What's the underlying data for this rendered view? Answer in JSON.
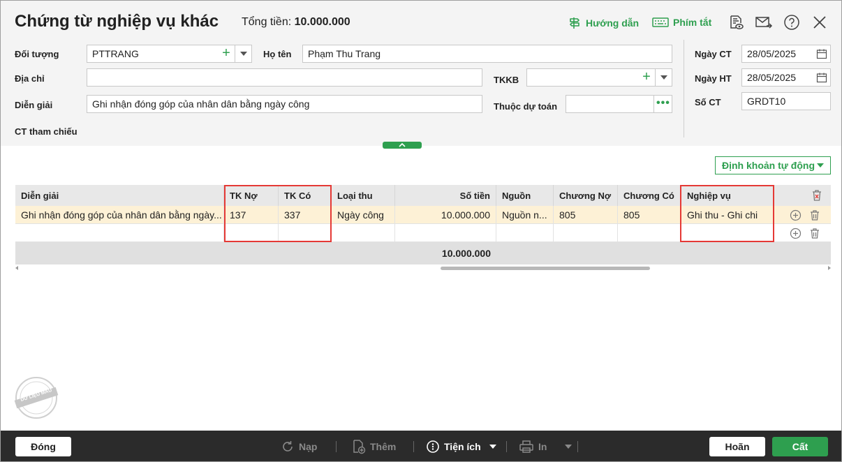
{
  "header": {
    "title": "Chứng từ nghiệp vụ khác",
    "total_label": "Tổng tiền:",
    "total_value": "10.000.000",
    "guide_label": "Hướng dẫn",
    "shortcut_label": "Phím tắt"
  },
  "form": {
    "doi_tuong_label": "Đối tượng",
    "doi_tuong_value": "PTTRANG",
    "ho_ten_label": "Họ tên",
    "ho_ten_value": "Phạm Thu Trang",
    "dia_chi_label": "Địa chỉ",
    "dia_chi_value": "",
    "tkkb_label": "TKKB",
    "tkkb_value": "",
    "dien_giai_label": "Diễn giải",
    "dien_giai_value": "Ghi nhận đóng góp của nhân dân bằng ngày công",
    "thuoc_du_toan_label": "Thuộc dự toán",
    "thuoc_du_toan_value": "",
    "ct_tham_chieu_label": "CT tham chiếu",
    "ngay_ct_label": "Ngày CT",
    "ngay_ct_value": "28/05/2025",
    "ngay_ht_label": "Ngày HT",
    "ngay_ht_value": "28/05/2025",
    "so_ct_label": "Số CT",
    "so_ct_value": "GRDT10"
  },
  "auto_button": {
    "label": "Định khoản tự động"
  },
  "grid": {
    "columns": [
      "Diễn giải",
      "TK Nợ",
      "TK Có",
      "Loại thu",
      "Số tiền",
      "Nguồn",
      "Chương Nợ",
      "Chương Có",
      "Nghiệp vụ"
    ],
    "rows": [
      [
        "Ghi nhận đóng góp của nhân dân bằng ngày...",
        "137",
        "337",
        "Ngày công",
        "10.000.000",
        "Nguồn n...",
        "805",
        "805",
        "Ghi thu - Ghi chi"
      ]
    ],
    "total": "10.000.000"
  },
  "stamp_text": "DỮ LIỆU MẪU",
  "footer": {
    "close_label": "Đóng",
    "reload_label": "Nạp",
    "add_label": "Thêm",
    "utility_label": "Tiện ích",
    "print_label": "In",
    "cancel_label": "Hoãn",
    "save_label": "Cất"
  },
  "colors": {
    "accent": "#2e9f4f",
    "highlight_row": "#fdf1d6",
    "annotation": "#e53935",
    "footer_bg": "#2b2b2b"
  }
}
